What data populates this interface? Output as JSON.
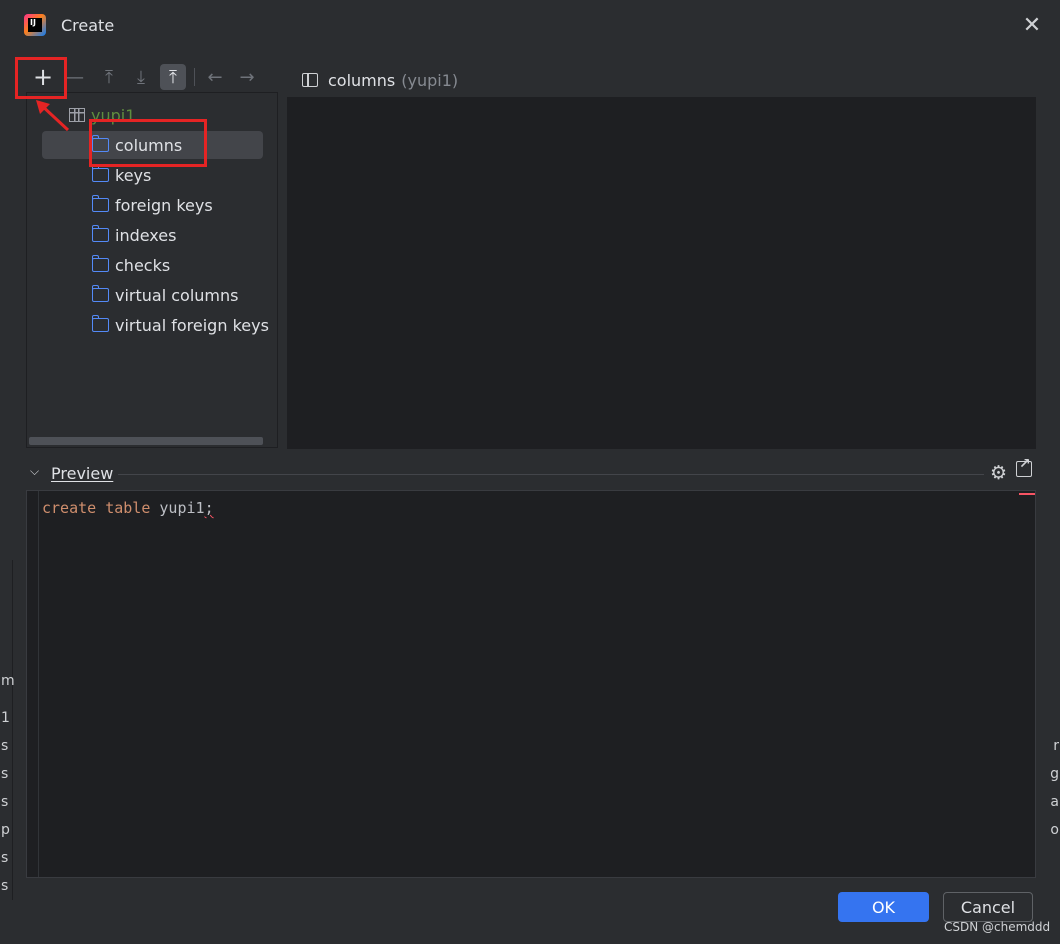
{
  "dialog": {
    "title": "Create",
    "close_icon": "close-icon",
    "app_icon": "intellij-idea-icon"
  },
  "toolbar": {
    "add": "+",
    "remove": "—",
    "move_up": "⤒",
    "move_down": "⤓",
    "move_top": "⤒",
    "back": "←",
    "forward": "→"
  },
  "tree": {
    "root": "yupi1",
    "items": [
      {
        "label": "columns",
        "selected": true
      },
      {
        "label": "keys"
      },
      {
        "label": "foreign keys"
      },
      {
        "label": "indexes"
      },
      {
        "label": "checks"
      },
      {
        "label": "virtual columns"
      },
      {
        "label": "virtual foreign keys"
      }
    ]
  },
  "properties": {
    "title": "columns",
    "subtitle": "(yupi1)"
  },
  "preview": {
    "label": "Preview",
    "code_keyword1": "create",
    "code_keyword2": "table",
    "code_identifier": "yupi1",
    "code_semicolon": ";"
  },
  "buttons": {
    "ok": "OK",
    "cancel": "Cancel"
  },
  "watermark": "CSDN @chemddd",
  "background": {
    "left_chars": [
      "m",
      "1",
      "s",
      "s",
      "s",
      "p",
      "s",
      "s"
    ],
    "right_chars": [
      "r",
      "g",
      "a",
      "o"
    ]
  },
  "colors": {
    "accent": "#3574f0",
    "annotation": "#e52424",
    "folder": "#548af7",
    "keyword": "#cf8e6d",
    "table_name": "#5f8e3e"
  }
}
